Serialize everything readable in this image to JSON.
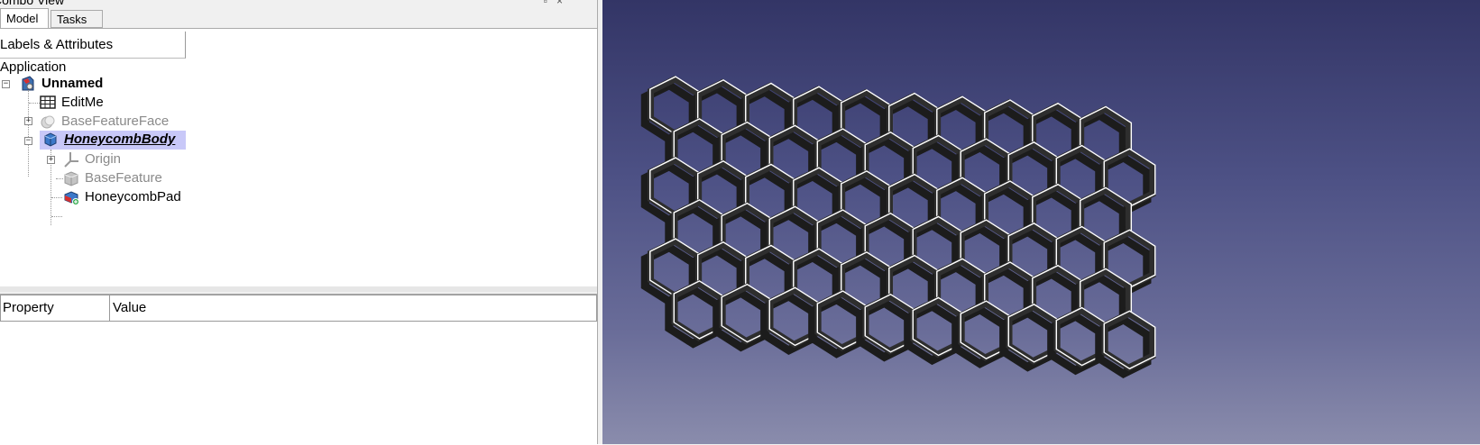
{
  "combo_view": {
    "title": "Combo View",
    "tabs": [
      {
        "label": "Model"
      },
      {
        "label": "Tasks"
      }
    ]
  },
  "tree": {
    "header": "Labels & Attributes",
    "root": "Application",
    "document": "Unnamed",
    "items": [
      {
        "label": "EditMe",
        "icon": "spreadsheet-icon"
      },
      {
        "label": "BaseFeatureFace",
        "icon": "face-feature-icon"
      },
      {
        "label": "HoneycombBody",
        "icon": "body-icon"
      },
      {
        "label": "Origin",
        "icon": "origin-axes-icon"
      },
      {
        "label": "BaseFeature",
        "icon": "base-feature-icon"
      },
      {
        "label": "HoneycombPad",
        "icon": "pad-icon"
      }
    ]
  },
  "properties": {
    "headers": {
      "property": "Property",
      "value": "Value"
    }
  },
  "viewport": {
    "background_top": "#333566",
    "background_bottom": "#8a8cac",
    "model_color": "#2e2e2e"
  }
}
